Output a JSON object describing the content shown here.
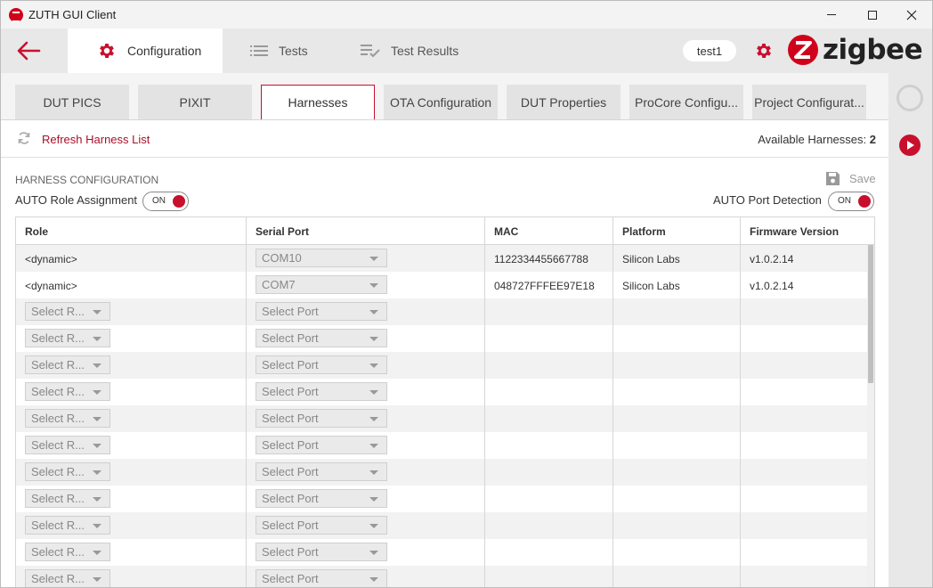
{
  "window": {
    "title": "ZUTH GUI Client"
  },
  "header": {
    "tabs": [
      {
        "label": "Configuration",
        "icon": "gear-icon"
      },
      {
        "label": "Tests",
        "icon": "list-icon"
      },
      {
        "label": "Test Results",
        "icon": "checklist-icon"
      }
    ],
    "user": "test1",
    "brand": "zigbee"
  },
  "subtabs": [
    "DUT PICS",
    "PIXIT",
    "Harnesses",
    "OTA Configuration",
    "DUT Properties",
    "ProCore Configu...",
    "Project Configurat..."
  ],
  "panel": {
    "refresh_label": "Refresh Harness List",
    "available_label": "Available Harnesses:",
    "available_count": "2",
    "section_title": "HARNESS CONFIGURATION",
    "save_label": "Save",
    "auto_role_label": "AUTO Role Assignment",
    "auto_port_label": "AUTO Port Detection",
    "toggle_on": "ON"
  },
  "table": {
    "columns": [
      "Role",
      "Serial Port",
      "MAC",
      "Platform",
      "Firmware Version"
    ],
    "rows": [
      {
        "role": "<dynamic>",
        "port": "COM10",
        "mac": "1122334455667788",
        "platform": "Silicon Labs",
        "firmware": "v1.0.2.14"
      },
      {
        "role": "<dynamic>",
        "port": "COM7",
        "mac": "048727FFFEE97E18",
        "platform": "Silicon Labs",
        "firmware": "v1.0.2.14"
      }
    ],
    "empty_role_placeholder": "Select R...",
    "empty_port_placeholder": "Select Port",
    "empty_row_count": 11
  },
  "colors": {
    "accent": "#c8102e",
    "brand": "#d0021b"
  }
}
